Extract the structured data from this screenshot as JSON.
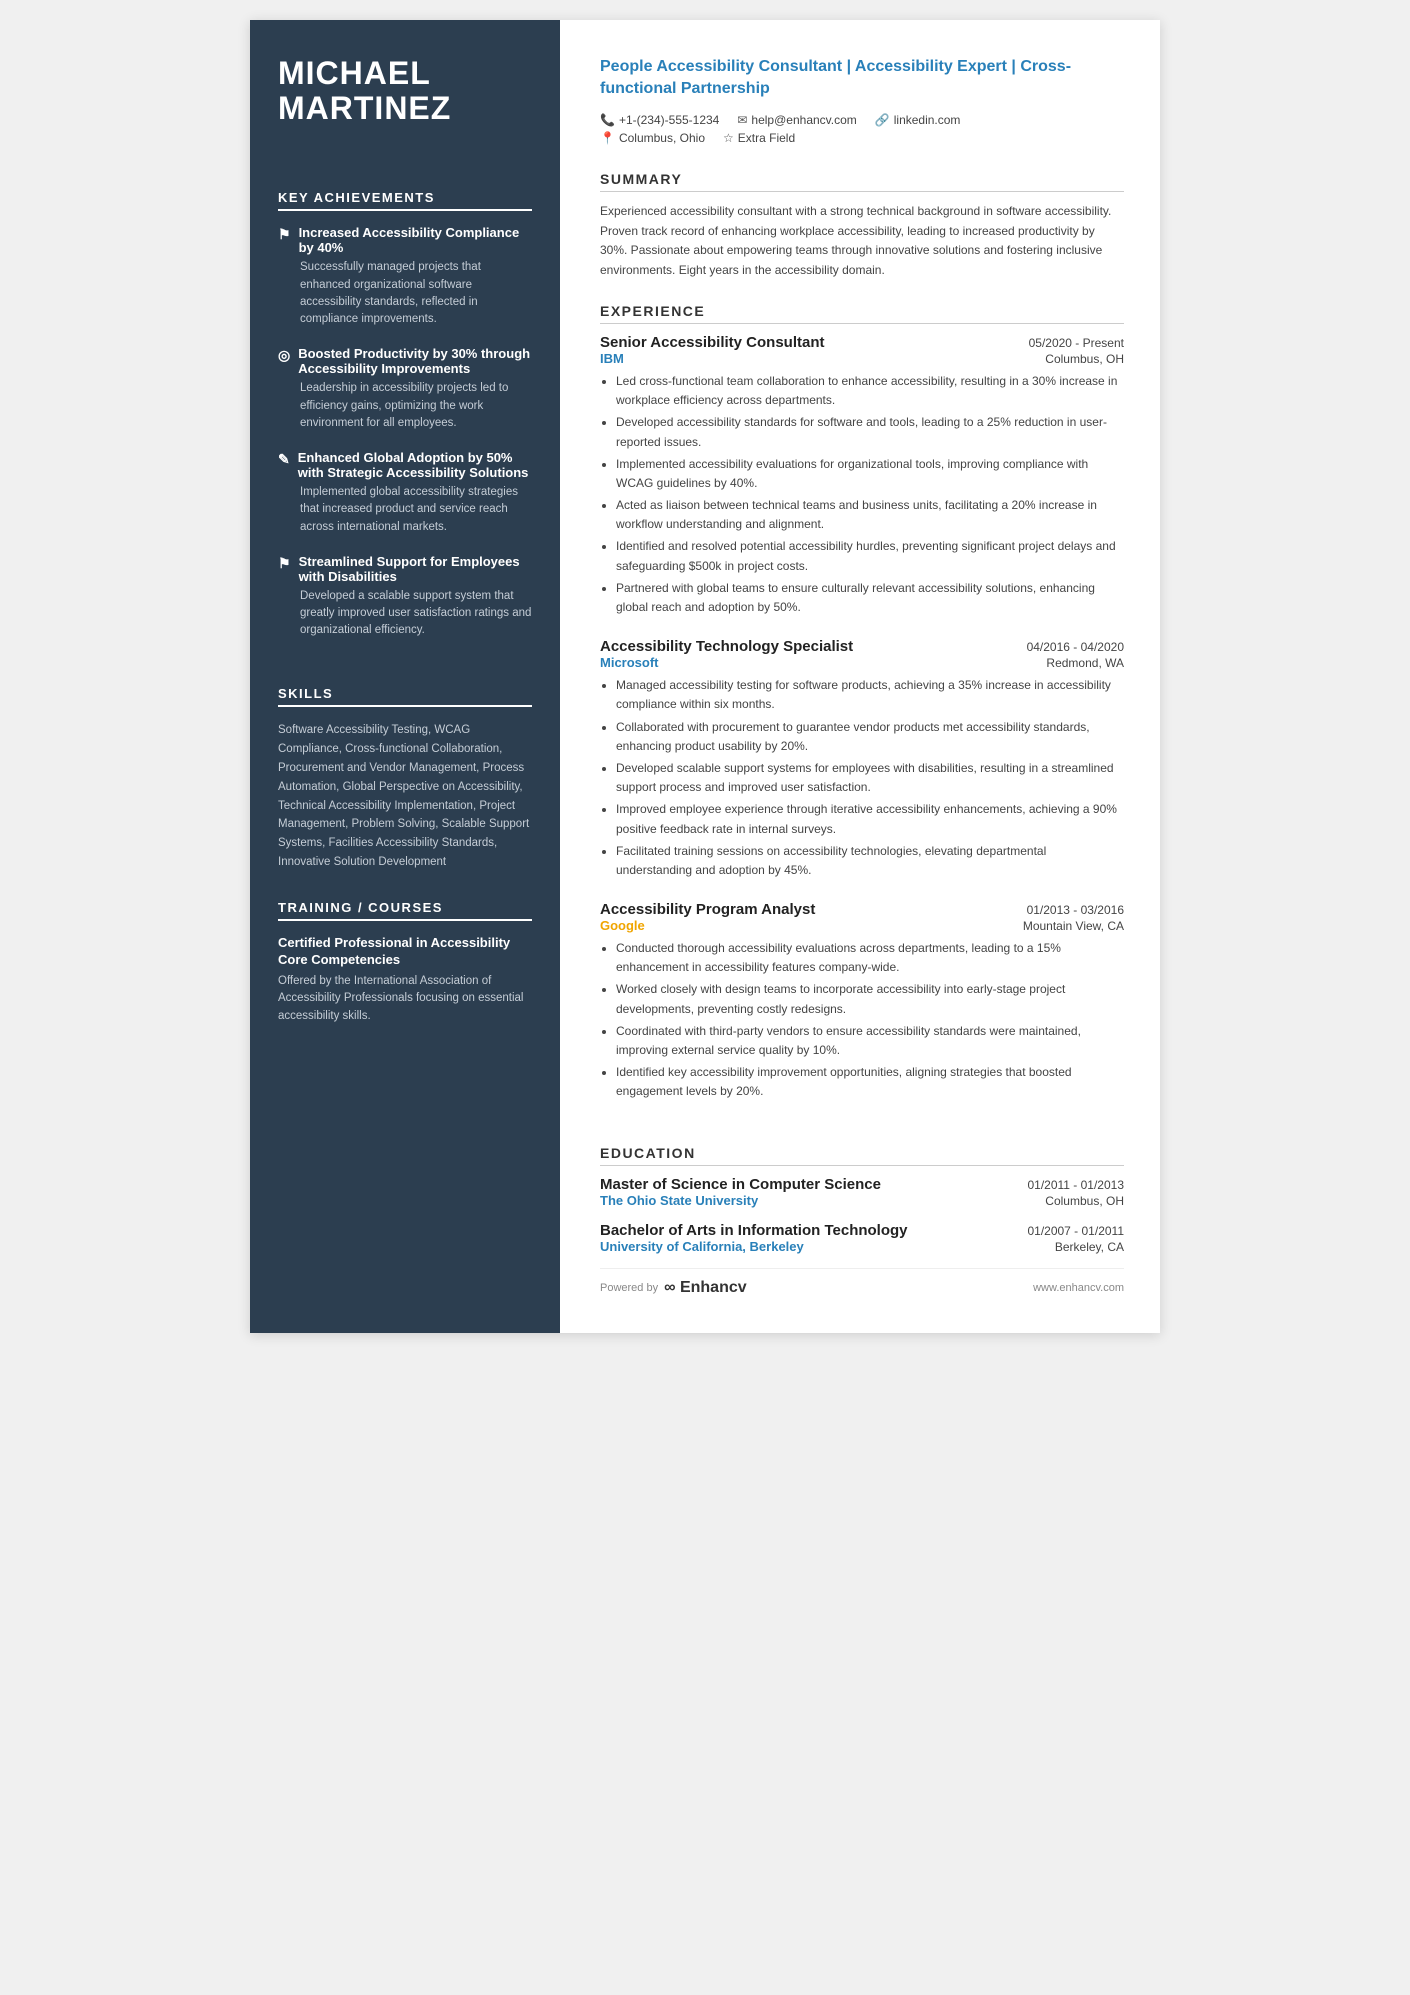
{
  "sidebar": {
    "name_line1": "MICHAEL",
    "name_line2": "MARTINEZ",
    "achievements_title": "KEY ACHIEVEMENTS",
    "achievements": [
      {
        "icon": "⚑",
        "title": "Increased Accessibility Compliance by 40%",
        "desc": "Successfully managed projects that enhanced organizational software accessibility standards, reflected in compliance improvements."
      },
      {
        "icon": "◎",
        "title": "Boosted Productivity by 30% through Accessibility Improvements",
        "desc": "Leadership in accessibility projects led to efficiency gains, optimizing the work environment for all employees."
      },
      {
        "icon": "✎",
        "title": "Enhanced Global Adoption by 50% with Strategic Accessibility Solutions",
        "desc": "Implemented global accessibility strategies that increased product and service reach across international markets."
      },
      {
        "icon": "⚑",
        "title": "Streamlined Support for Employees with Disabilities",
        "desc": "Developed a scalable support system that greatly improved user satisfaction ratings and organizational efficiency."
      }
    ],
    "skills_title": "SKILLS",
    "skills_text": "Software Accessibility Testing, WCAG Compliance, Cross-functional Collaboration, Procurement and Vendor Management, Process Automation, Global Perspective on Accessibility, Technical Accessibility Implementation, Project Management, Problem Solving, Scalable Support Systems, Facilities Accessibility Standards, Innovative Solution Development",
    "training_title": "TRAINING / COURSES",
    "training": [
      {
        "title": "Certified Professional in Accessibility Core Competencies",
        "desc": "Offered by the International Association of Accessibility Professionals focusing on essential accessibility skills."
      }
    ]
  },
  "main": {
    "header": {
      "title": "People Accessibility Consultant | Accessibility Expert | Cross-functional Partnership",
      "phone": "+1-(234)-555-1234",
      "email": "help@enhancv.com",
      "linkedin": "linkedin.com",
      "location": "Columbus, Ohio",
      "extra": "Extra Field"
    },
    "summary_title": "SUMMARY",
    "summary_text": "Experienced accessibility consultant with a strong technical background in software accessibility. Proven track record of enhancing workplace accessibility, leading to increased productivity by 30%. Passionate about empowering teams through innovative solutions and fostering inclusive environments. Eight years in the accessibility domain.",
    "experience_title": "EXPERIENCE",
    "experience": [
      {
        "job_title": "Senior Accessibility Consultant",
        "dates": "05/2020 - Present",
        "company": "IBM",
        "company_class": "ibm",
        "location": "Columbus, OH",
        "bullets": [
          "Led cross-functional team collaboration to enhance accessibility, resulting in a 30% increase in workplace efficiency across departments.",
          "Developed accessibility standards for software and tools, leading to a 25% reduction in user-reported issues.",
          "Implemented accessibility evaluations for organizational tools, improving compliance with WCAG guidelines by 40%.",
          "Acted as liaison between technical teams and business units, facilitating a 20% increase in workflow understanding and alignment.",
          "Identified and resolved potential accessibility hurdles, preventing significant project delays and safeguarding $500k in project costs.",
          "Partnered with global teams to ensure culturally relevant accessibility solutions, enhancing global reach and adoption by 50%."
        ]
      },
      {
        "job_title": "Accessibility Technology Specialist",
        "dates": "04/2016 - 04/2020",
        "company": "Microsoft",
        "company_class": "microsoft",
        "location": "Redmond, WA",
        "bullets": [
          "Managed accessibility testing for software products, achieving a 35% increase in accessibility compliance within six months.",
          "Collaborated with procurement to guarantee vendor products met accessibility standards, enhancing product usability by 20%.",
          "Developed scalable support systems for employees with disabilities, resulting in a streamlined support process and improved user satisfaction.",
          "Improved employee experience through iterative accessibility enhancements, achieving a 90% positive feedback rate in internal surveys.",
          "Facilitated training sessions on accessibility technologies, elevating departmental understanding and adoption by 45%."
        ]
      },
      {
        "job_title": "Accessibility Program Analyst",
        "dates": "01/2013 - 03/2016",
        "company": "Google",
        "company_class": "google",
        "location": "Mountain View, CA",
        "bullets": [
          "Conducted thorough accessibility evaluations across departments, leading to a 15% enhancement in accessibility features company-wide.",
          "Worked closely with design teams to incorporate accessibility into early-stage project developments, preventing costly redesigns.",
          "Coordinated with third-party vendors to ensure accessibility standards were maintained, improving external service quality by 10%.",
          "Identified key accessibility improvement opportunities, aligning strategies that boosted engagement levels by 20%."
        ]
      }
    ],
    "education_title": "EDUCATION",
    "education": [
      {
        "degree": "Master of Science in Computer Science",
        "dates": "01/2011 - 01/2013",
        "school": "The Ohio State University",
        "location": "Columbus, OH"
      },
      {
        "degree": "Bachelor of Arts in Information Technology",
        "dates": "01/2007 - 01/2011",
        "school": "University of California, Berkeley",
        "location": "Berkeley, CA"
      }
    ],
    "footer": {
      "powered_by": "Powered by",
      "logo": "Enhancv",
      "website": "www.enhancv.com"
    }
  }
}
